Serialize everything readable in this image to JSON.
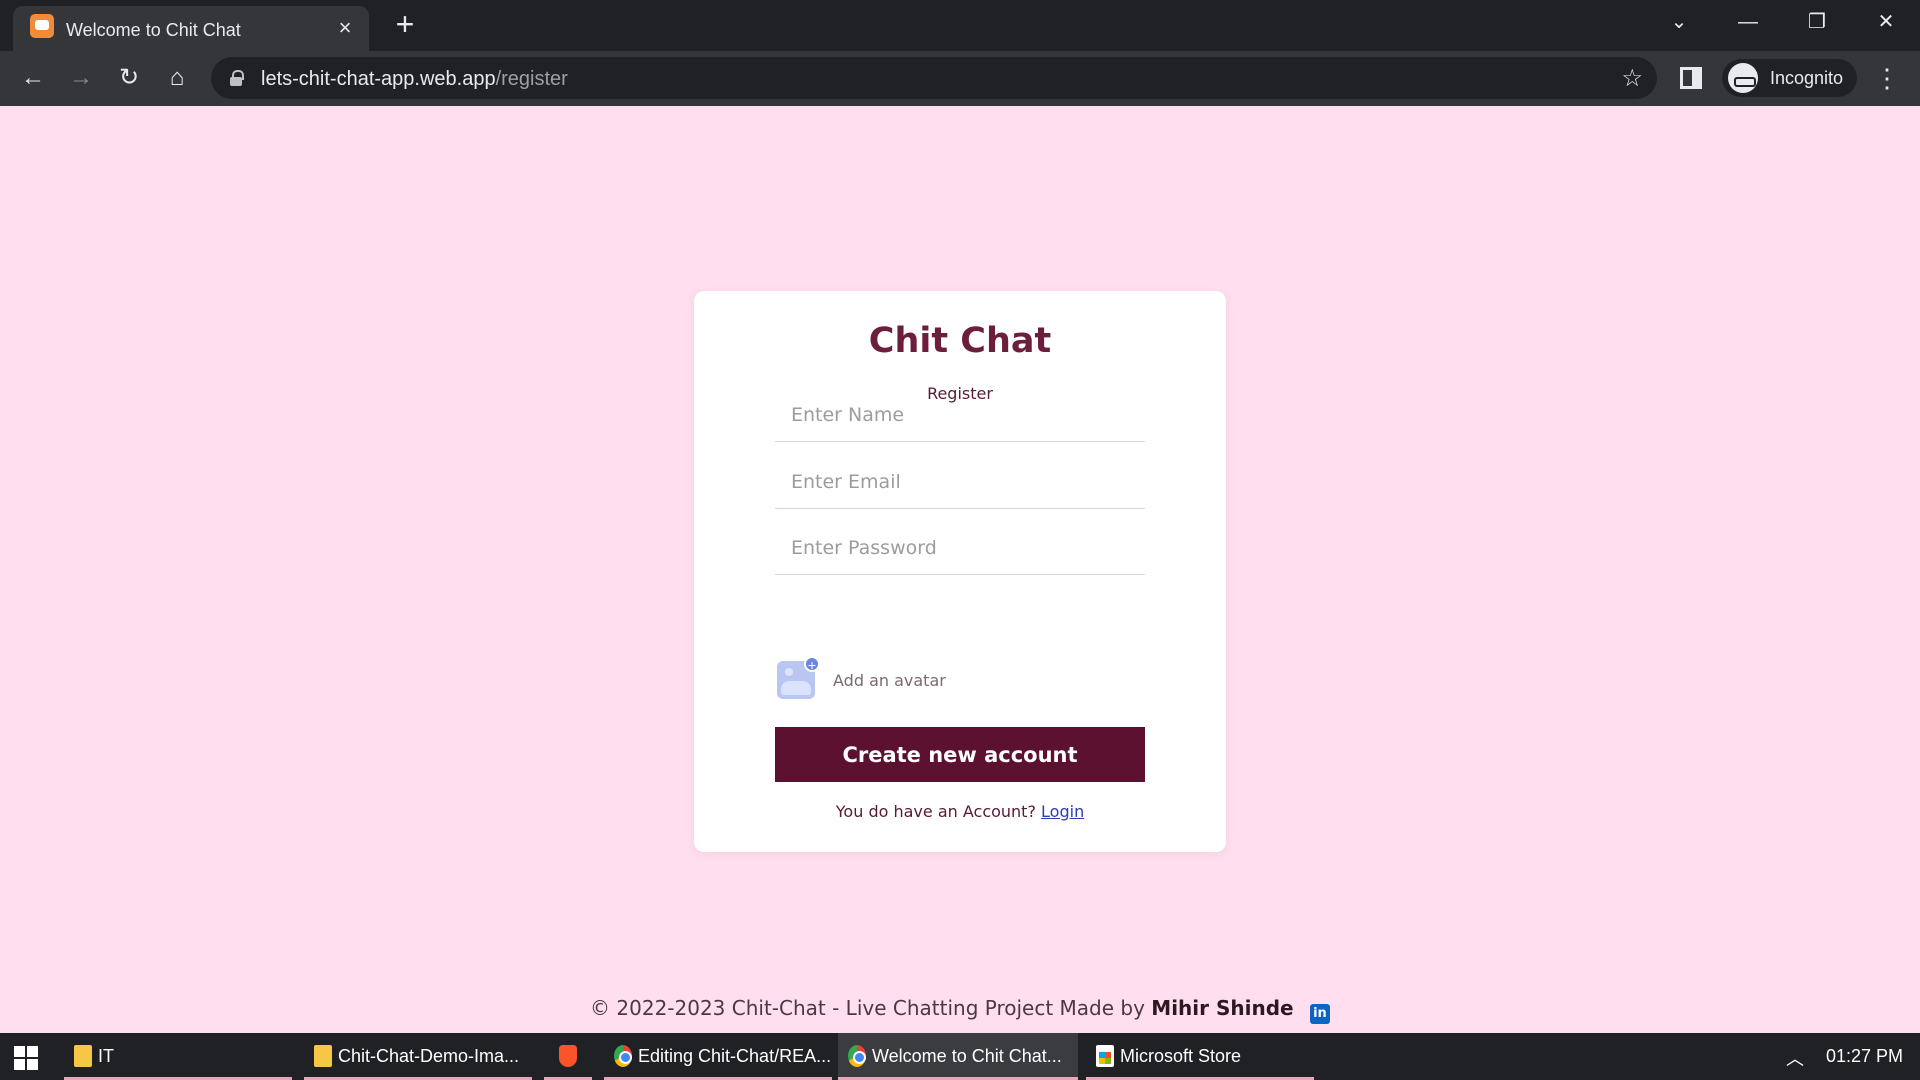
{
  "browser": {
    "tab_title": "Welcome to Chit Chat",
    "url_host": "lets-chit-chat-app.web.app",
    "url_path": "/register",
    "profile_label": "Incognito"
  },
  "form": {
    "app_name": "Chit Chat",
    "subtitle": "Register",
    "name_placeholder": "Enter Name",
    "email_placeholder": "Enter Email",
    "password_placeholder": "Enter Password",
    "avatar_label": "Add an avatar",
    "submit_label": "Create new account",
    "login_prompt": "You do have an Account?",
    "login_link": "Login"
  },
  "footer": {
    "text": "© 2022-2023 Chit-Chat - Live Chatting Project Made by",
    "author": "Mihir Shinde",
    "social_icon": "linkedin-icon"
  },
  "taskbar": {
    "items": [
      {
        "label": "IT",
        "icon": "folder-icon"
      },
      {
        "label": "Chit-Chat-Demo-Ima...",
        "icon": "folder-icon"
      },
      {
        "label": "",
        "icon": "brave-icon"
      },
      {
        "label": "Editing Chit-Chat/REA...",
        "icon": "chrome-icon"
      },
      {
        "label": "Welcome to Chit Chat...",
        "icon": "chrome-icon"
      },
      {
        "label": "Microsoft Store",
        "icon": "store-icon"
      }
    ],
    "clock": "01:27 PM"
  },
  "colors": {
    "page_background": "#ffdfef",
    "brand": "#6b1f3c",
    "button": "#5c1130",
    "link": "#2a3bb8"
  }
}
